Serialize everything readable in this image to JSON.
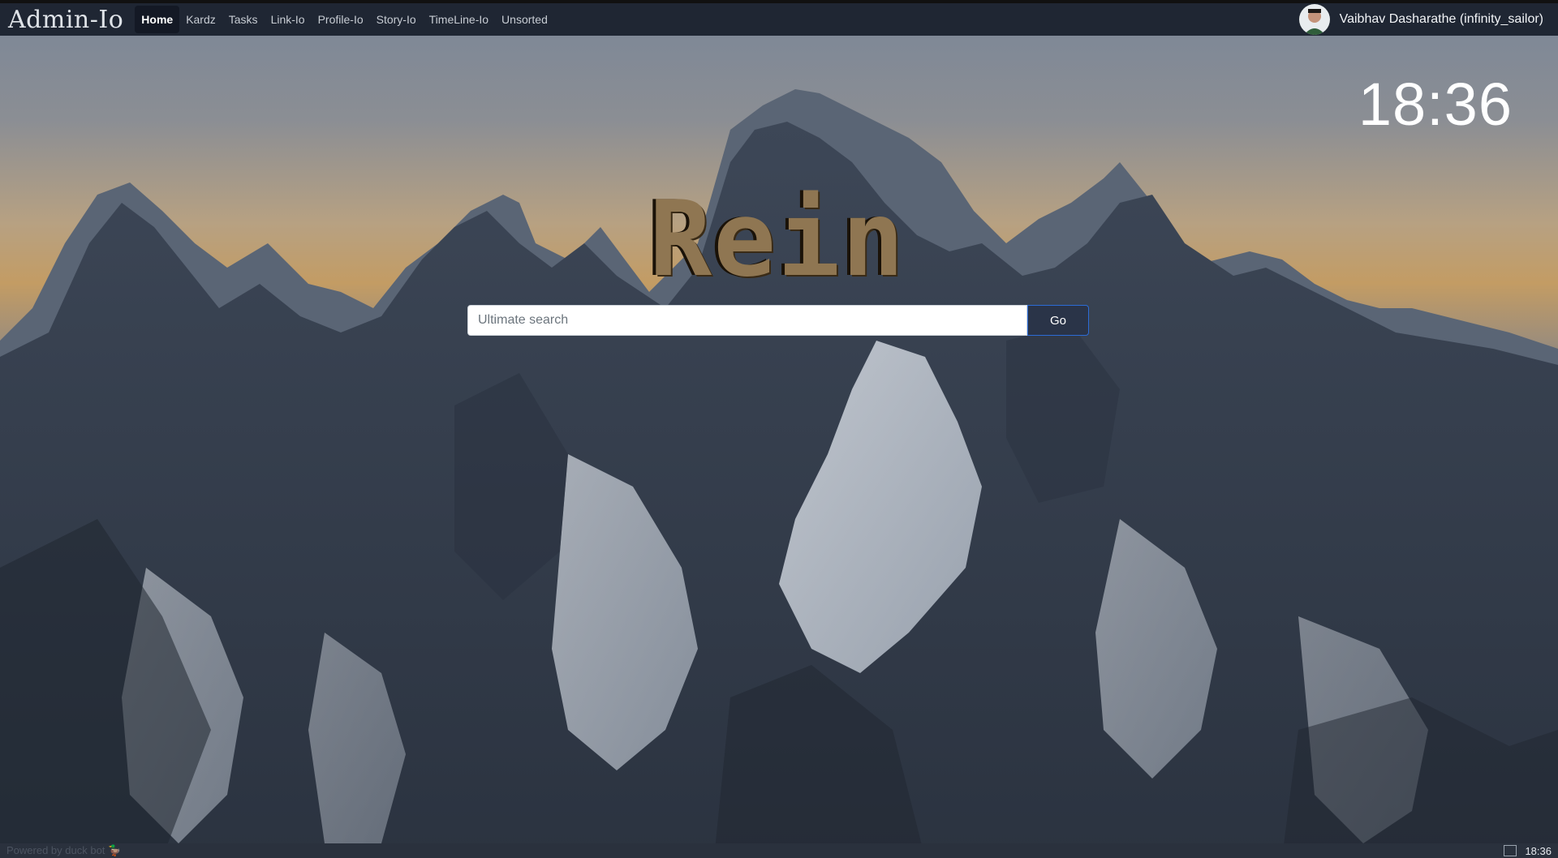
{
  "navbar": {
    "brand": "Admin-Io",
    "items": [
      {
        "label": "Home",
        "active": true
      },
      {
        "label": "Kardz"
      },
      {
        "label": "Tasks"
      },
      {
        "label": "Link-Io"
      },
      {
        "label": "Profile-Io"
      },
      {
        "label": "Story-Io"
      },
      {
        "label": "TimeLine-Io"
      },
      {
        "label": "Unsorted"
      }
    ],
    "user": {
      "name": "Vaibhav Dasharathe (infinity_sailor)",
      "avatar_icon": "user-avatar"
    }
  },
  "clock": {
    "time": "18:36"
  },
  "hero": {
    "logo_text": "Rein"
  },
  "search": {
    "placeholder": "Ultimate search",
    "value": "",
    "button_label": "Go"
  },
  "footer": {
    "powered_by": "Powered by duck bot",
    "bot_icon": "duck-icon",
    "time": "18:36",
    "fullscreen_icon": "fullscreen-icon"
  },
  "colors": {
    "navbar_bg": "#1f2633",
    "button_border": "#2c6bd6",
    "logo": "#8f7652"
  }
}
